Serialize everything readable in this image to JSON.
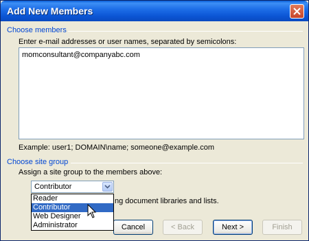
{
  "window": {
    "title": "Add New Members"
  },
  "choose_members": {
    "heading": "Choose members",
    "instruction": "Enter e-mail addresses or user names, separated by semicolons:",
    "value": "momconsultant@companyabc.com",
    "example": "Example: user1; DOMAIN\\name; someone@example.com"
  },
  "site_group": {
    "heading": "Choose site group",
    "instruction": "Assign a site group to the members above:",
    "selected": "Contributor",
    "options": [
      "Reader",
      "Contributor",
      "Web Designer",
      "Administrator"
    ],
    "partial_description": "ng document libraries and lists."
  },
  "buttons": {
    "cancel": "Cancel",
    "back": "< Back",
    "next": "Next >",
    "finish": "Finish"
  },
  "colors": {
    "section_heading": "#0046d5",
    "selection": "#316ac5",
    "titlebar": "#0b55d4"
  }
}
